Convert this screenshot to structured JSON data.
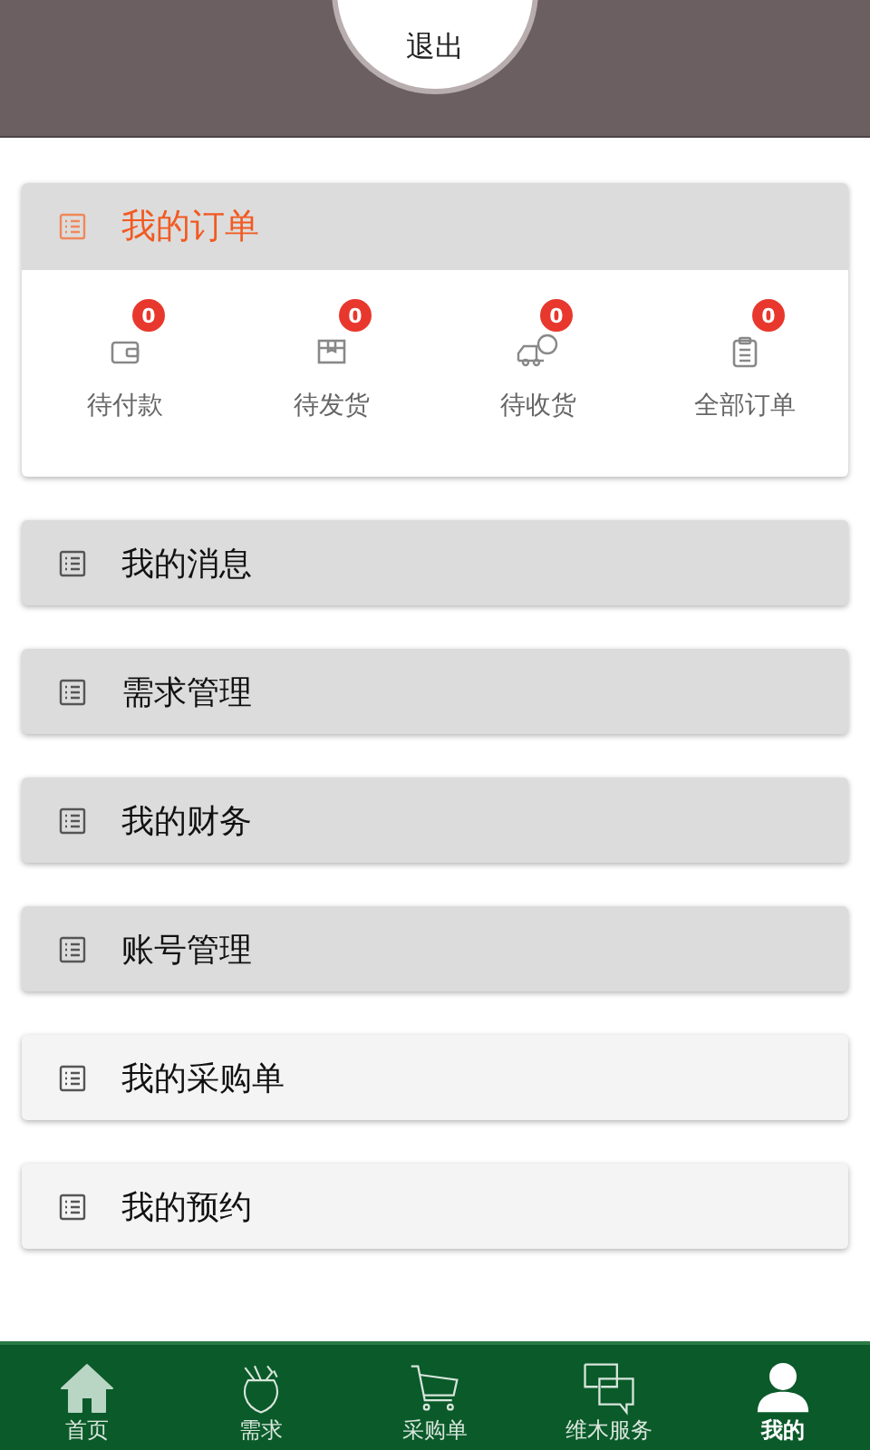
{
  "header": {
    "logout_label": "退出"
  },
  "orders": {
    "title": "我的订单",
    "items": [
      {
        "kind": "wallet",
        "label": "待付款",
        "count": "0"
      },
      {
        "kind": "box",
        "label": "待发货",
        "count": "0"
      },
      {
        "kind": "truck",
        "label": "待收货",
        "count": "0"
      },
      {
        "kind": "clipboard",
        "label": "全部订单",
        "count": "0"
      }
    ]
  },
  "menu": [
    {
      "label": "我的消息",
      "highlighted": true
    },
    {
      "label": "需求管理",
      "highlighted": true
    },
    {
      "label": "我的财务",
      "highlighted": true
    },
    {
      "label": "账号管理",
      "highlighted": true
    },
    {
      "label": "我的采购单",
      "highlighted": false
    },
    {
      "label": "我的预约",
      "highlighted": false
    }
  ],
  "tab_bar": [
    {
      "kind": "home",
      "label": "首页",
      "selected": false
    },
    {
      "kind": "bag",
      "label": "需求",
      "selected": false
    },
    {
      "kind": "cart",
      "label": "采购单",
      "selected": false
    },
    {
      "kind": "chat",
      "label": "维木服务",
      "selected": false
    },
    {
      "kind": "person",
      "label": "我的",
      "selected": true
    }
  ]
}
